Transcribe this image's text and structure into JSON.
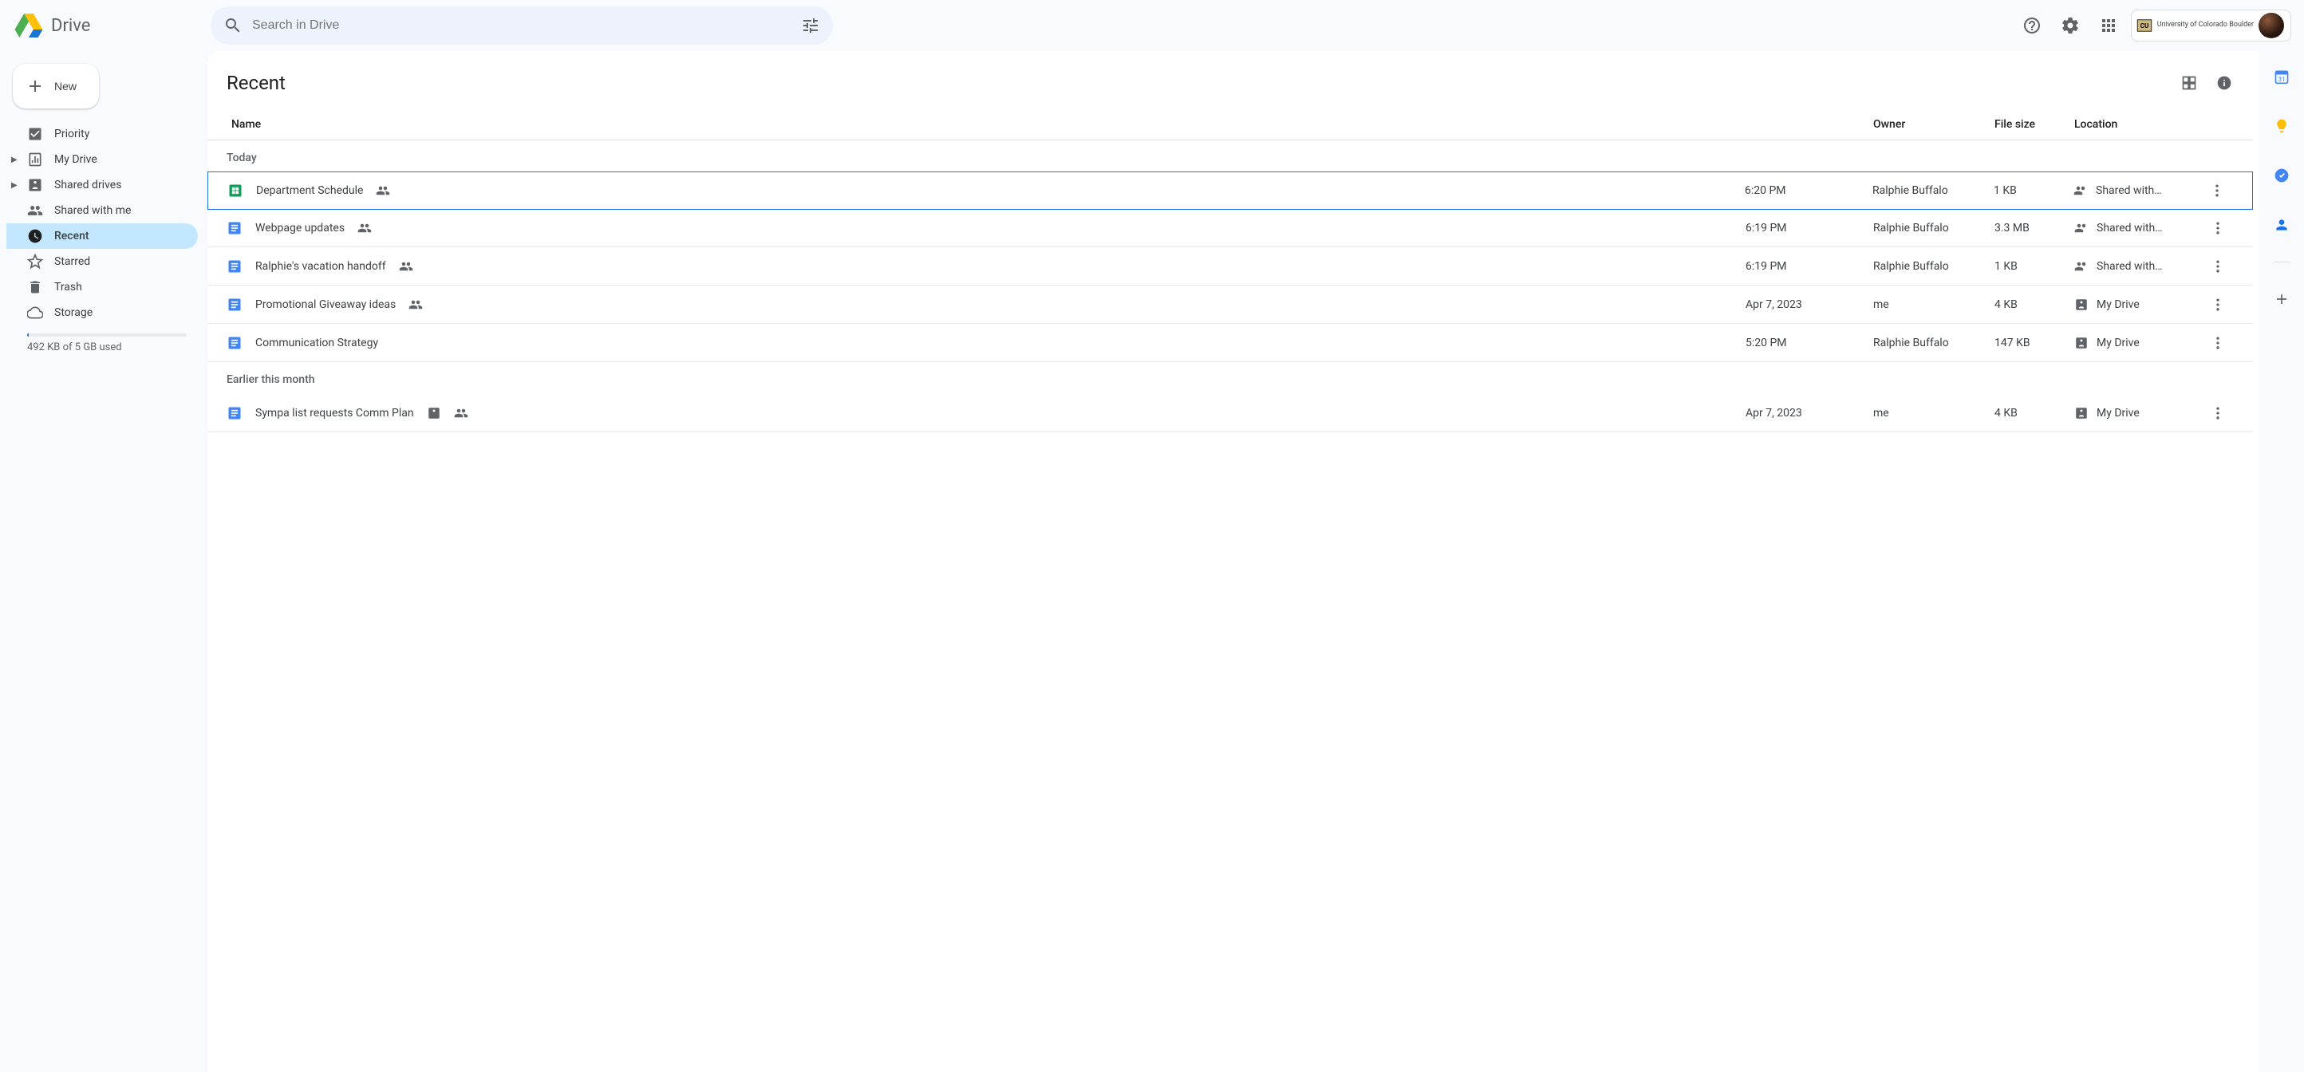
{
  "app": {
    "name": "Drive"
  },
  "search": {
    "placeholder": "Search in Drive"
  },
  "newButton": {
    "label": "New"
  },
  "sidebar": {
    "items": [
      {
        "label": "Priority"
      },
      {
        "label": "My Drive"
      },
      {
        "label": "Shared drives"
      },
      {
        "label": "Shared with me"
      },
      {
        "label": "Recent"
      },
      {
        "label": "Starred"
      },
      {
        "label": "Trash"
      },
      {
        "label": "Storage"
      }
    ],
    "storage": {
      "used_label": "492 KB of 5 GB used"
    }
  },
  "main": {
    "title": "Recent",
    "columns": {
      "name": "Name",
      "owner": "Owner",
      "size": "File size",
      "location": "Location"
    },
    "groups": [
      {
        "label": "Today",
        "rows": [
          {
            "type": "sheets",
            "name": "Department Schedule",
            "shared": true,
            "time": "6:20 PM",
            "owner": "Ralphie Buffalo",
            "size": "1 KB",
            "location": "Shared with…",
            "loc_icon": "shared",
            "selected": true
          },
          {
            "type": "docs",
            "name": "Webpage updates",
            "shared": true,
            "time": "6:19 PM",
            "owner": "Ralphie Buffalo",
            "size": "3.3 MB",
            "location": "Shared with…",
            "loc_icon": "shared"
          },
          {
            "type": "docs",
            "name": "Ralphie's vacation handoff",
            "shared": true,
            "time": "6:19 PM",
            "owner": "Ralphie Buffalo",
            "size": "1 KB",
            "location": "Shared with…",
            "loc_icon": "shared"
          },
          {
            "type": "docs",
            "name": "Promotional Giveaway ideas",
            "shared": true,
            "time": "Apr 7, 2023",
            "owner": "me",
            "size": "4 KB",
            "location": "My Drive",
            "loc_icon": "drive"
          },
          {
            "type": "docs",
            "name": "Communication Strategy",
            "shared": false,
            "time": "5:20 PM",
            "owner": "Ralphie Buffalo",
            "size": "147 KB",
            "location": "My Drive",
            "loc_icon": "drive"
          }
        ]
      },
      {
        "label": "Earlier this month",
        "rows": [
          {
            "type": "docs",
            "name": "Sympa list requests Comm Plan",
            "shared": true,
            "has_drive_badge": true,
            "time": "Apr 7, 2023",
            "owner": "me",
            "size": "4 KB",
            "location": "My Drive",
            "loc_icon": "drive"
          }
        ]
      }
    ]
  },
  "org": {
    "name": "University of Colorado Boulder"
  }
}
